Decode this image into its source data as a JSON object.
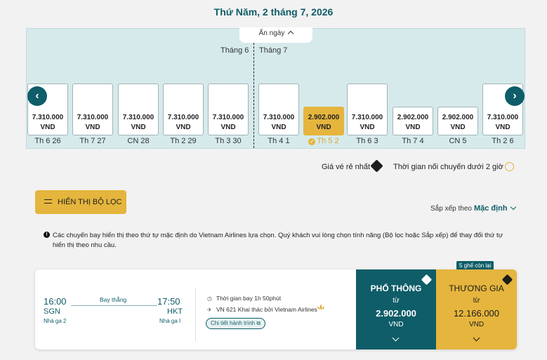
{
  "header": {
    "date_title": "Thứ Năm, 2 tháng 7, 2026"
  },
  "calendar": {
    "hide_label": "Ẩn ngày",
    "months": [
      "Tháng 6",
      "Tháng 7"
    ],
    "days": [
      {
        "price": "7.310.000",
        "currency": "VND",
        "label": "Th 6 26"
      },
      {
        "price": "7.310.000",
        "currency": "VND",
        "label": "Th 7 27"
      },
      {
        "price": "7.310.000",
        "currency": "VND",
        "label": "CN 28"
      },
      {
        "price": "7.310.000",
        "currency": "VND",
        "label": "Th 2 29"
      },
      {
        "price": "7.310.000",
        "currency": "VND",
        "label": "Th 3 30"
      },
      {
        "price": "7.310.000",
        "currency": "VND",
        "label": "Th 4 1"
      },
      {
        "price": "2.902.000",
        "currency": "VND",
        "label": "Th 5 2",
        "selected": true
      },
      {
        "price": "7.310.000",
        "currency": "VND",
        "label": "Th 6 3"
      },
      {
        "price": "2.902.000",
        "currency": "VND",
        "label": "Th 7 4"
      },
      {
        "price": "2.902.000",
        "currency": "VND",
        "label": "CN 5"
      },
      {
        "price": "7.310.000",
        "currency": "VND",
        "label": "Th 2 6"
      }
    ]
  },
  "legend": {
    "cheapest": "Giá vé rẻ nhất",
    "short_connection": "Thời gian nối chuyến dưới 2 giờ"
  },
  "filter": {
    "label": "HIỂN THỊ BỘ LỌC"
  },
  "sort": {
    "label": "Sắp xếp theo",
    "value": "Mặc định"
  },
  "notice": {
    "text": "Các chuyến bay hiển thị theo thứ tự mặc định do Vietnam Airlines lựa chọn. Quý khách vui lòng chọn tính năng (Bộ lọc hoặc Sắp xếp) để thay đổi thứ tự hiển thị theo nhu cầu."
  },
  "flight": {
    "depart_time": "16:00",
    "depart_code": "SGN",
    "depart_terminal": "Nhà ga 2",
    "arrive_time": "17:50",
    "arrive_code": "HKT",
    "arrive_terminal": "Nhà ga I",
    "direct": "Bay thẳng",
    "duration": "Thời gian bay 1h 50phút",
    "operator": "VN 621 Khai thác bởi Vietnam Airlines",
    "detail_button": "Chi tiết hành trình",
    "seats_left": "5 ghế còn lại",
    "fares": [
      {
        "name": "PHỔ THÔNG",
        "from": "từ",
        "price": "2.902.000",
        "currency": "VND"
      },
      {
        "name": "THƯƠNG GIA",
        "from": "từ",
        "price": "12.166.000",
        "currency": "VND"
      }
    ]
  },
  "colors": {
    "primary": "#0e5d68",
    "accent": "#e5b53d",
    "calendar_bg": "#d6eaec"
  },
  "icons": {
    "prev": "chevron-left-icon",
    "next": "chevron-right-icon",
    "tag": "tag-icon",
    "timer": "timer-icon"
  }
}
